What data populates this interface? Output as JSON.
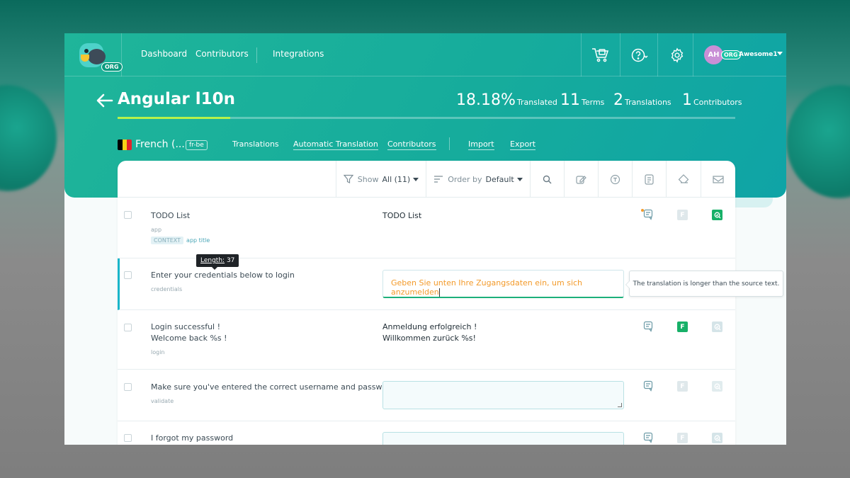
{
  "nav": {
    "org_badge": "ORG",
    "links": [
      "Dashboard",
      "Contributors",
      "Integrations"
    ],
    "icons": [
      "cart-icon",
      "help-icon",
      "gear-icon"
    ],
    "user": {
      "initials": "AH",
      "org": "ORG",
      "name": "Awesome1"
    }
  },
  "project": {
    "title": "Angular l10n",
    "progress_percent": 18.18,
    "stats": [
      {
        "value": "18.18%",
        "label": "Translated"
      },
      {
        "value": "11",
        "label": "Terms"
      },
      {
        "value": "2",
        "label": "Translations"
      },
      {
        "value": "1",
        "label": "Contributors"
      }
    ]
  },
  "language": {
    "name": "French (...",
    "code": "fr-be",
    "flag_colors": [
      "#000000",
      "#f7d117",
      "#e2242c"
    ]
  },
  "subnav": [
    "Translations",
    "Automatic Translation",
    "Contributors",
    "Import",
    "Export"
  ],
  "toolbar": {
    "show_label": "Show",
    "show_value": "All (11)",
    "order_label": "Order by",
    "order_value": "Default"
  },
  "rows": [
    {
      "source": [
        "TODO List"
      ],
      "context": "app",
      "tag_label": "CONTEXT",
      "tag_value": "app title",
      "translation": [
        "TODO List"
      ],
      "f": "off",
      "q": "on"
    },
    {
      "source": [
        "Enter your credentials below to login"
      ],
      "context": "credentials",
      "translation_input": "Geben Sie unten Ihre Zugangsdaten ein, um sich anzumelden"
    },
    {
      "source": [
        "Login successful !",
        "Welcome back %s !"
      ],
      "context": "login",
      "translation": [
        "Anmeldung erfolgreich !",
        "Willkommen zurück %s!"
      ],
      "f": "on",
      "q": "off"
    },
    {
      "source": [
        "Make sure you've entered the correct username and password"
      ],
      "context": "validate",
      "f": "off",
      "q": "off"
    },
    {
      "source": [
        "I forgot my password"
      ],
      "f": "off",
      "q": "off"
    }
  ],
  "tooltips": {
    "length_label": "Length:",
    "length_value": "37",
    "warning": "The translation is longer than the source text."
  },
  "badge_letter": "F"
}
